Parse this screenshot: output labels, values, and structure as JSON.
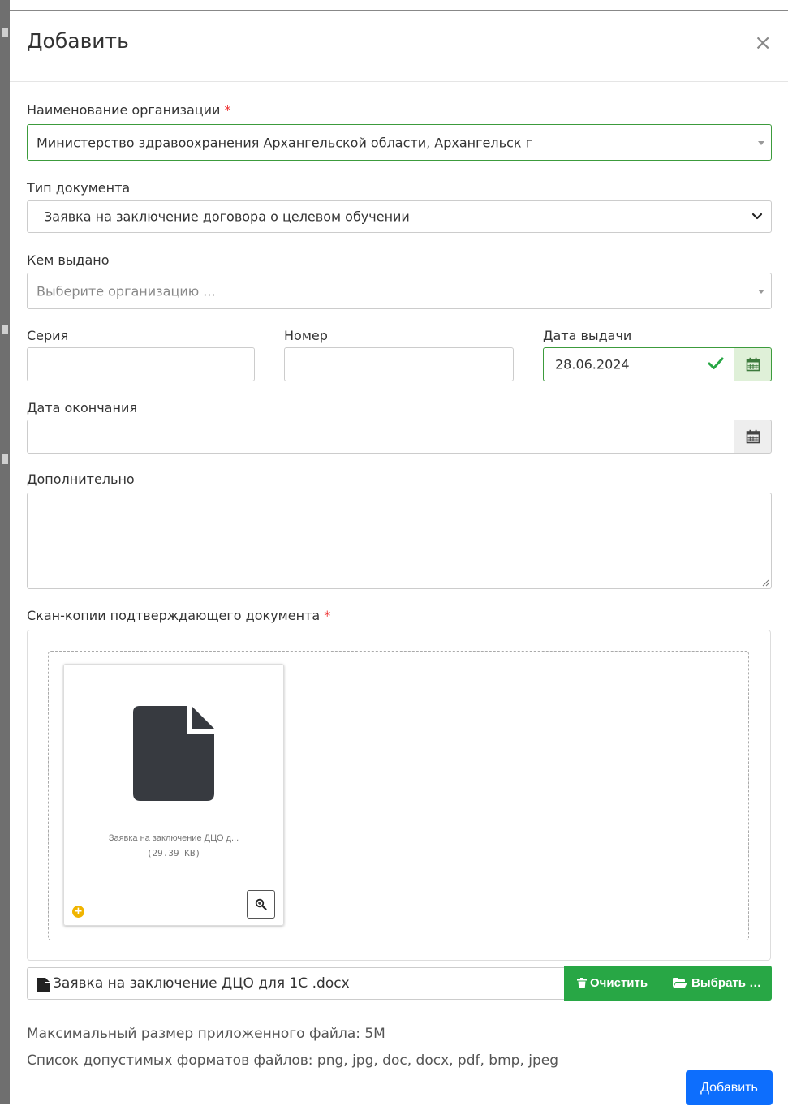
{
  "modal": {
    "title": "Добавить",
    "close_label": "×"
  },
  "fields": {
    "organization": {
      "label": "Наименование организации",
      "required_mark": "*",
      "value": "Министерство здравоохранения Архангельской области, Архангельск г"
    },
    "doc_type": {
      "label": "Тип документа",
      "value": "Заявка на заключение договора о целевом обучении"
    },
    "issued_by": {
      "label": "Кем выдано",
      "placeholder": "Выберите организацию ..."
    },
    "series": {
      "label": "Серия",
      "value": ""
    },
    "number": {
      "label": "Номер",
      "value": ""
    },
    "issue_date": {
      "label": "Дата выдачи",
      "value": "28.06.2024"
    },
    "end_date": {
      "label": "Дата окончания",
      "value": ""
    },
    "additional": {
      "label": "Дополнительно",
      "value": ""
    },
    "scans": {
      "label": "Скан-копии подтверждающего документа",
      "required_mark": "*"
    }
  },
  "upload": {
    "file_preview": {
      "name": "Заявка на заключение ДЦО д...",
      "size": "(29.39 KB)",
      "status_glyph": "+"
    },
    "caption": "Заявка на заключение ДЦО для 1С .docx",
    "clear_label": "Очистить",
    "browse_label": "Выбрать …"
  },
  "hints": {
    "max_size": "Максимальный размер приложенного файла: 5M",
    "formats": "Список допустимых форматов файлов: png, jpg, doc, docx, pdf, bmp, jpeg"
  },
  "submit_label": "Добавить",
  "colors": {
    "success": "#28a745",
    "success_border": "#3c9b3c",
    "primary": "#0d6efd",
    "required": "#e33333",
    "warning": "#f0b400"
  }
}
